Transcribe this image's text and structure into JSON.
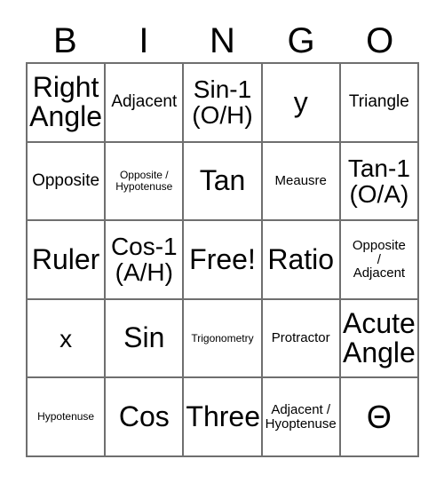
{
  "card": {
    "type": "bingo-card",
    "columns": 5,
    "rows": 5,
    "headers": [
      "B",
      "I",
      "N",
      "G",
      "O"
    ],
    "grid": [
      [
        {
          "text": "Right\nAngle",
          "size": "xl"
        },
        {
          "text": "Adjacent",
          "size": "md"
        },
        {
          "text": "Sin-1\n(O/H)",
          "size": "lg"
        },
        {
          "text": "y",
          "size": "xl"
        },
        {
          "text": "Triangle",
          "size": "md"
        }
      ],
      [
        {
          "text": "Opposite",
          "size": "md"
        },
        {
          "text": "Opposite /\nHypotenuse",
          "size": "xs"
        },
        {
          "text": "Tan",
          "size": "xl"
        },
        {
          "text": "Meausre",
          "size": "sm"
        },
        {
          "text": "Tan-1\n(O/A)",
          "size": "lg"
        }
      ],
      [
        {
          "text": "Ruler",
          "size": "xl"
        },
        {
          "text": "Cos-1\n(A/H)",
          "size": "lg"
        },
        {
          "text": "Free!",
          "size": "xl"
        },
        {
          "text": "Ratio",
          "size": "xl"
        },
        {
          "text": "Opposite\n/\nAdjacent",
          "size": "sm"
        }
      ],
      [
        {
          "text": "x",
          "size": "lg"
        },
        {
          "text": "Sin",
          "size": "xl"
        },
        {
          "text": "Trigonometry",
          "size": "xs"
        },
        {
          "text": "Protractor",
          "size": "sm"
        },
        {
          "text": "Acute\nAngle",
          "size": "xl"
        }
      ],
      [
        {
          "text": "Hypotenuse",
          "size": "xs"
        },
        {
          "text": "Cos",
          "size": "xl"
        },
        {
          "text": "Three",
          "size": "xl"
        },
        {
          "text": "Adjacent /\nHyoptenuse",
          "size": "sm"
        },
        {
          "text": "Θ",
          "size": "theta"
        }
      ]
    ],
    "colors": {
      "background": "#ffffff",
      "text": "#000000",
      "grid_line": "#6f6f6f"
    }
  }
}
